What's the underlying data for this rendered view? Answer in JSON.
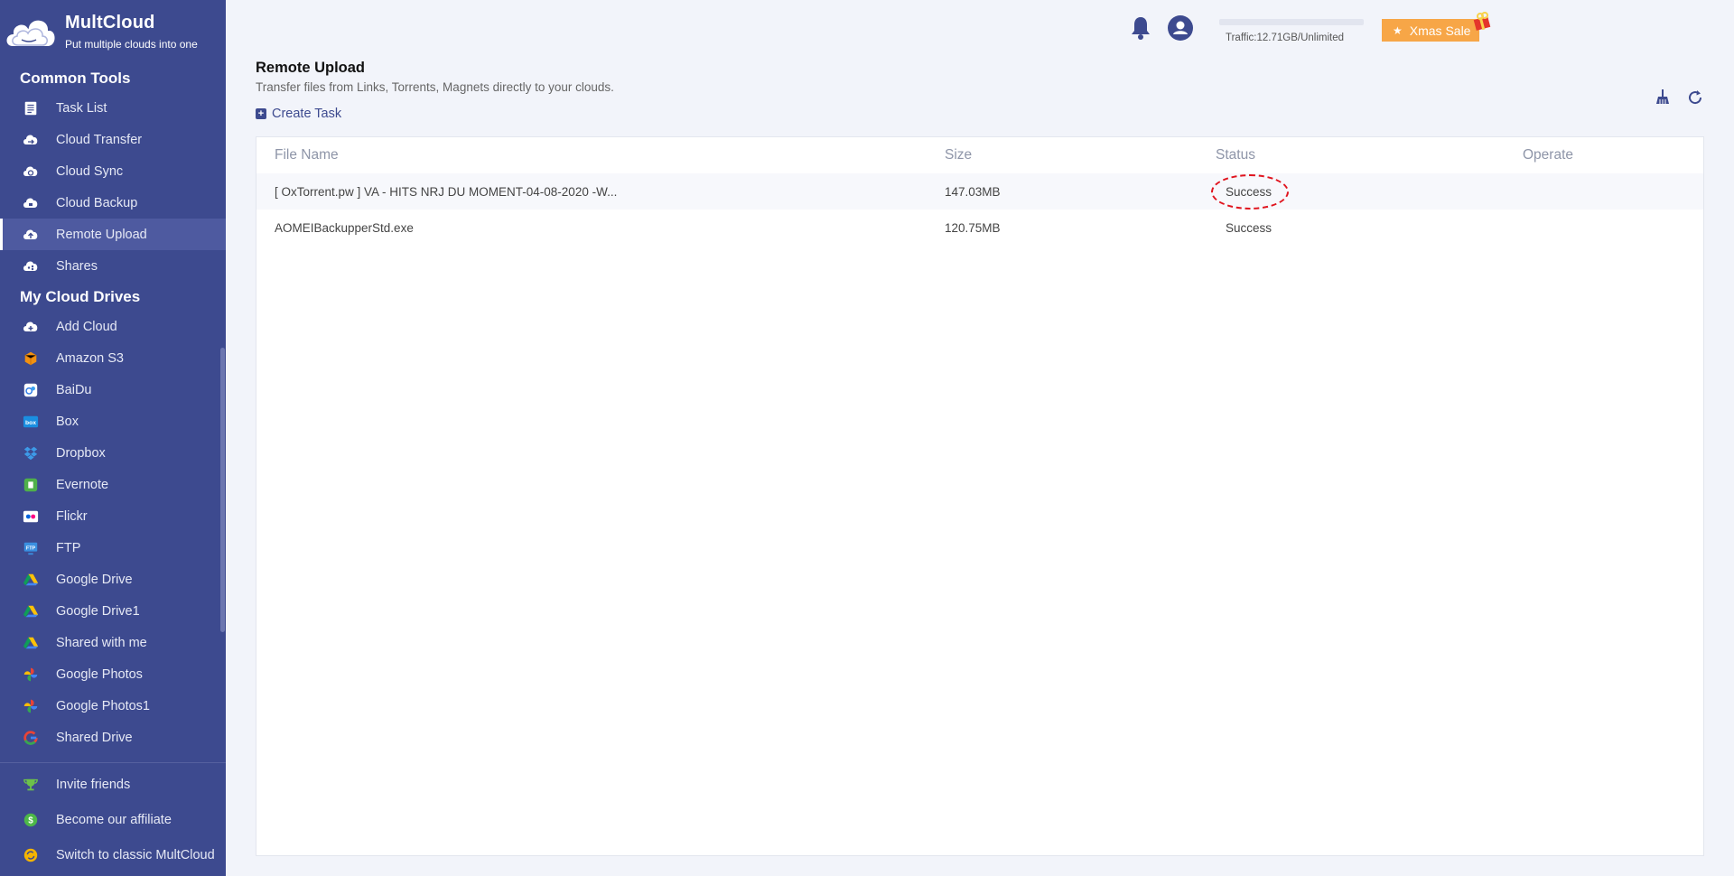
{
  "app": {
    "logo_title": "MultCloud",
    "logo_subtitle": "Put multiple clouds into one"
  },
  "sidebar": {
    "common_tools_title": "Common Tools",
    "common_tools": [
      {
        "label": "Task List",
        "icon": "task-list-icon"
      },
      {
        "label": "Cloud Transfer",
        "icon": "cloud-transfer-icon"
      },
      {
        "label": "Cloud Sync",
        "icon": "cloud-sync-icon"
      },
      {
        "label": "Cloud Backup",
        "icon": "cloud-backup-icon"
      },
      {
        "label": "Remote Upload",
        "icon": "cloud-upload-icon",
        "active": true
      },
      {
        "label": "Shares",
        "icon": "cloud-share-icon"
      }
    ],
    "my_cloud_drives_title": "My Cloud Drives",
    "drives": [
      {
        "label": "Add Cloud",
        "icon": "add-cloud-icon"
      },
      {
        "label": "Amazon S3",
        "icon": "amazon-s3-icon"
      },
      {
        "label": "BaiDu",
        "icon": "baidu-icon"
      },
      {
        "label": "Box",
        "icon": "box-icon"
      },
      {
        "label": "Dropbox",
        "icon": "dropbox-icon"
      },
      {
        "label": "Evernote",
        "icon": "evernote-icon"
      },
      {
        "label": "Flickr",
        "icon": "flickr-icon"
      },
      {
        "label": "FTP",
        "icon": "ftp-icon"
      },
      {
        "label": "Google Drive",
        "icon": "google-drive-icon"
      },
      {
        "label": "Google Drive1",
        "icon": "google-drive-icon"
      },
      {
        "label": "Shared with me",
        "icon": "google-drive-icon"
      },
      {
        "label": "Google Photos",
        "icon": "google-photos-icon"
      },
      {
        "label": "Google Photos1",
        "icon": "google-photos-icon"
      },
      {
        "label": "Shared Drive",
        "icon": "google-icon"
      }
    ],
    "footer": [
      {
        "label": "Invite friends",
        "icon": "trophy-icon"
      },
      {
        "label": "Become our affiliate",
        "icon": "dollar-icon"
      },
      {
        "label": "Switch to classic MultCloud",
        "icon": "switch-icon"
      }
    ]
  },
  "topbar": {
    "traffic_text": "Traffic:12.71GB/Unlimited",
    "traffic_used_fraction": 0.0,
    "sale_label": "Xmas Sale"
  },
  "main": {
    "title": "Remote Upload",
    "subtitle": "Transfer files from Links, Torrents, Magnets directly to your clouds.",
    "create_task_label": "Create Task",
    "table": {
      "headers": [
        "File Name",
        "Size",
        "Status",
        "Operate"
      ],
      "rows": [
        {
          "name": "[ OxTorrent.pw ] VA - HITS NRJ DU MOMENT-04-08-2020 -W...",
          "size": "147.03MB",
          "status": "Success"
        },
        {
          "name": "AOMEIBackupperStd.exe",
          "size": "120.75MB",
          "status": "Success"
        }
      ]
    }
  },
  "colors": {
    "sidebar_bg": "#3d4a8f",
    "accent": "#3d4a8f",
    "sale": "#f7a647",
    "highlight": "#e0141e"
  }
}
